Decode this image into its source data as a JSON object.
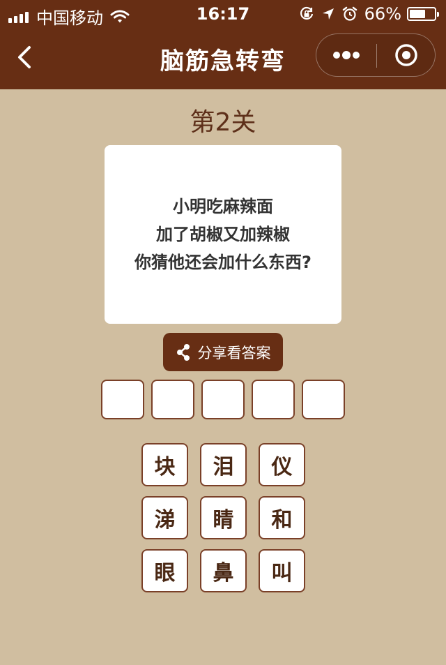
{
  "status_bar": {
    "carrier": "中国移动",
    "time": "16:17",
    "battery_percent": "66%",
    "battery_level": 0.66
  },
  "nav": {
    "title": "脑筋急转弯"
  },
  "game": {
    "level_label": "第2关",
    "question_lines": [
      "小明吃麻辣面",
      "加了胡椒又加辣椒",
      "你猜他还会加什么东西?"
    ],
    "share_label": "分享看答案",
    "answer_slot_count": 5,
    "tiles": [
      "块",
      "泪",
      "仪",
      "涕",
      "睛",
      "和",
      "眼",
      "鼻",
      "叫"
    ]
  },
  "colors": {
    "brand": "#672e14",
    "background": "#d0bea0",
    "tile_border": "#7a4028"
  }
}
